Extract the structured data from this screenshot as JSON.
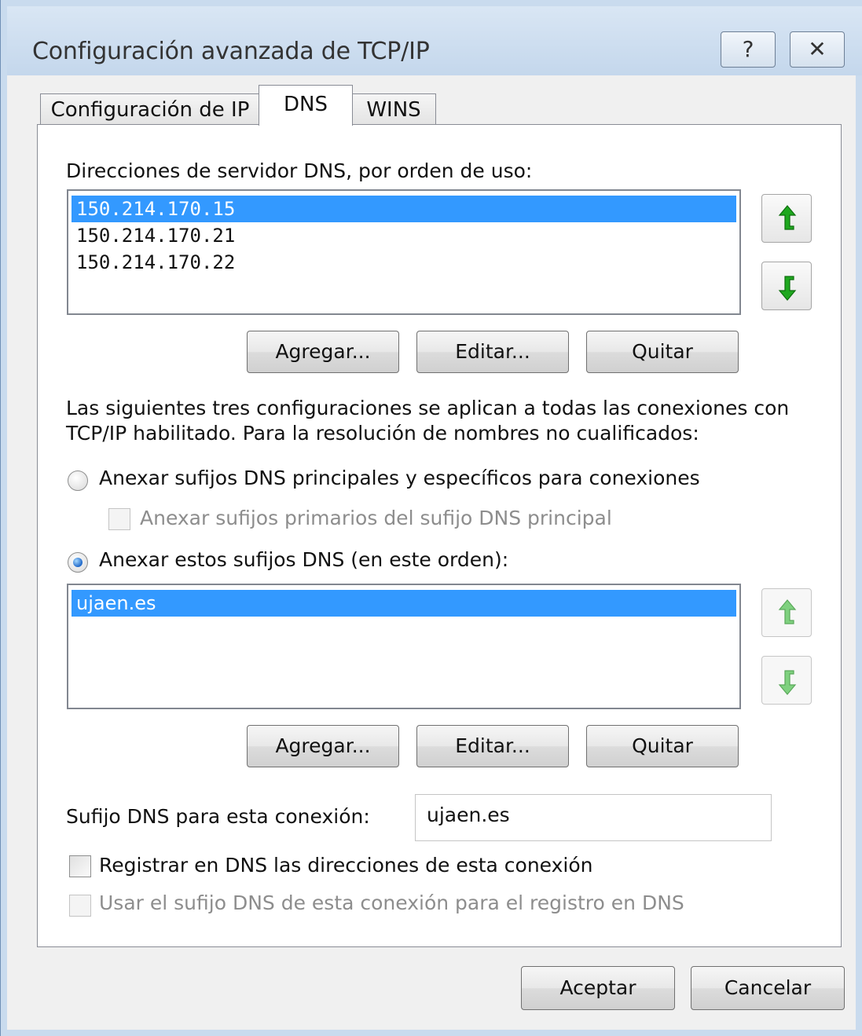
{
  "window": {
    "title": "Configuración avanzada de TCP/IP",
    "help_glyph": "?",
    "close_glyph": "✕"
  },
  "tabs": [
    {
      "label": "Configuración de IP",
      "active": false
    },
    {
      "label": "DNS",
      "active": true
    },
    {
      "label": "WINS",
      "active": false
    }
  ],
  "dns_servers": {
    "label": "Direcciones de servidor DNS, por orden de uso:",
    "items": [
      "150.214.170.15",
      "150.214.170.21",
      "150.214.170.22"
    ],
    "selected_index": 0,
    "buttons": {
      "add": "Agregar...",
      "edit": "Editar...",
      "remove": "Quitar"
    }
  },
  "resolution": {
    "description_line1": "Las siguientes tres configuraciones se aplican a todas las conexiones con",
    "description_line2": "TCP/IP habilitado. Para la resolución de nombres no cualificados:",
    "radio_primary_label": "Anexar sufijos DNS principales y específicos para conexiones",
    "radio_primary_checked": false,
    "check_parent_label": "Anexar sufijos primarios del sufijo DNS principal",
    "radio_these_label": "Anexar estos sufijos DNS (en este orden):",
    "radio_these_checked": true
  },
  "suffixes": {
    "items": [
      "ujaen.es"
    ],
    "selected_index": 0,
    "buttons": {
      "add": "Agregar...",
      "edit": "Editar...",
      "remove": "Quitar"
    }
  },
  "connection": {
    "suffix_label": "Sufijo DNS para esta conexión:",
    "suffix_value": "ujaen.es",
    "register_label": "Registrar en DNS las direcciones de esta conexión",
    "register_checked": false,
    "use_suffix_label": "Usar el sufijo DNS de esta conexión para el registro en DNS",
    "use_suffix_checked": false
  },
  "footer": {
    "ok_label": "Aceptar",
    "cancel_label": "Cancelar"
  },
  "colors": {
    "selection": "#3399ff",
    "arrow_green": "#1fa81f"
  },
  "icons": [
    "help-icon",
    "close-icon",
    "arrow-up-icon",
    "arrow-down-icon"
  ]
}
